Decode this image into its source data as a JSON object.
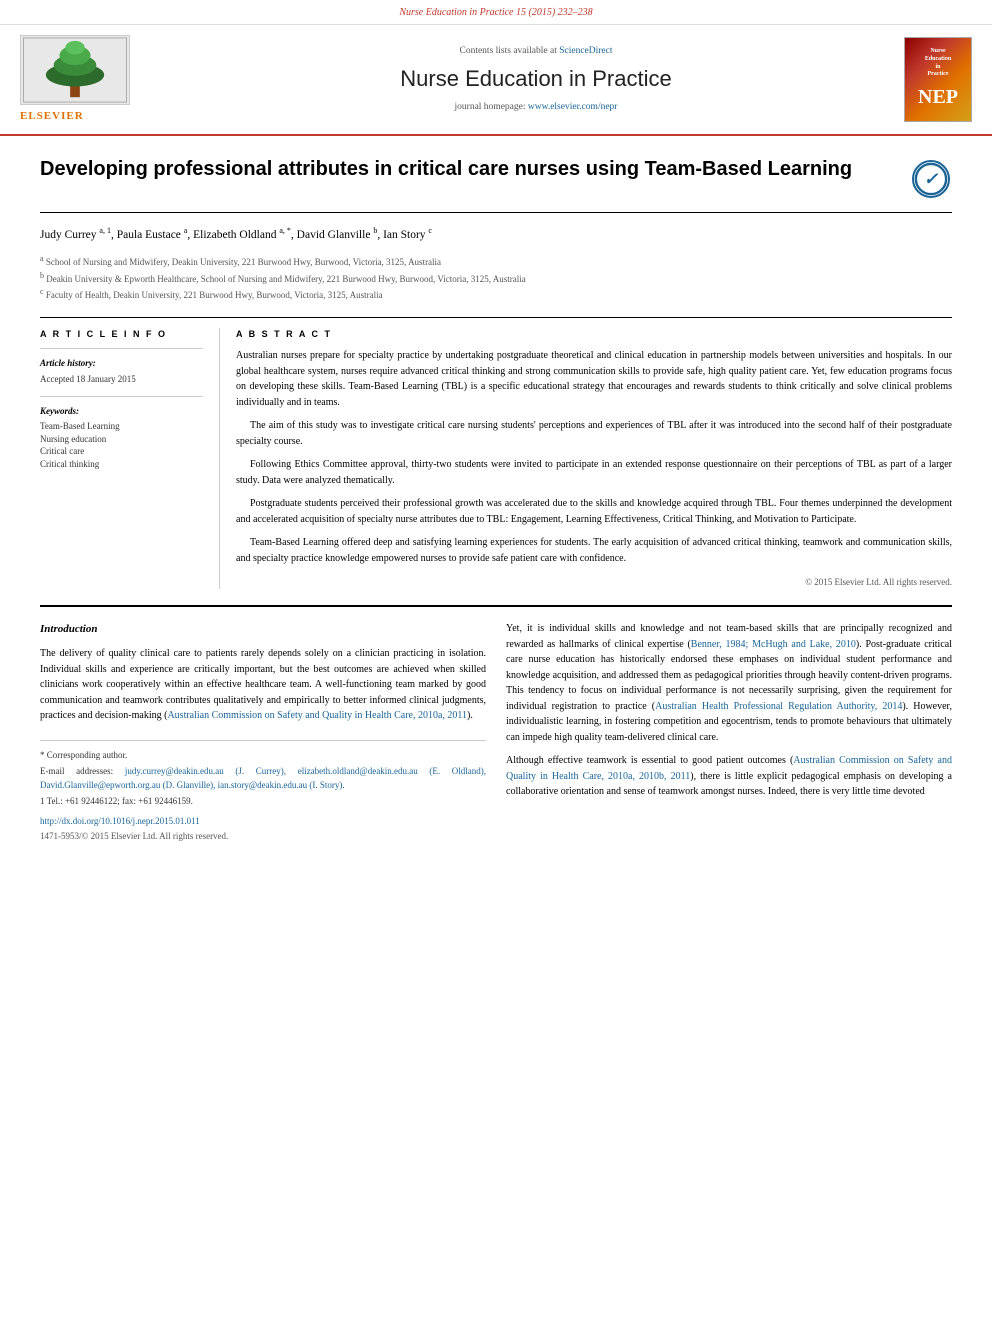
{
  "citation_bar": {
    "text": "Nurse Education in Practice 15 (2015) 232–238"
  },
  "header": {
    "contents_text": "Contents lists available at",
    "contents_link": "ScienceDirect",
    "journal_title": "Nurse Education in Practice",
    "homepage_text": "journal homepage:",
    "homepage_link": "www.elsevier.com/nepr",
    "elsevier_label": "ELSEVIER",
    "cover_title_lines": [
      "Nurse",
      "Education",
      "in",
      "Practice"
    ],
    "cover_initials": "NEP"
  },
  "article": {
    "title": "Developing professional attributes in critical care nurses using Team-Based Learning",
    "crossmark_symbol": "✓",
    "authors": "Judy Currey a, 1, Paula Eustace a, Elizabeth Oldland a, *, David Glanville b, Ian Story c",
    "affiliations": [
      {
        "sup": "a",
        "text": "School of Nursing and Midwifery, Deakin University, 221 Burwood Hwy, Burwood, Victoria, 3125, Australia"
      },
      {
        "sup": "b",
        "text": "Deakin University & Epworth Healthcare, School of Nursing and Midwifery, 221 Burwood Hwy, Burwood, Victoria, 3125, Australia"
      },
      {
        "sup": "c",
        "text": "Faculty of Health, Deakin University, 221 Burwood Hwy, Burwood, Victoria, 3125, Australia"
      }
    ]
  },
  "article_info": {
    "section_title": "A R T I C L E   I N F O",
    "history_label": "Article history:",
    "accepted_text": "Accepted 18 January 2015",
    "keywords_label": "Keywords:",
    "keywords": [
      "Team-Based Learning",
      "Nursing education",
      "Critical care",
      "Critical thinking"
    ]
  },
  "abstract": {
    "section_title": "A B S T R A C T",
    "paragraphs": [
      "Australian nurses prepare for specialty practice by undertaking postgraduate theoretical and clinical education in partnership models between universities and hospitals. In our global healthcare system, nurses require advanced critical thinking and strong communication skills to provide safe, high quality patient care. Yet, few education programs focus on developing these skills. Team-Based Learning (TBL) is a specific educational strategy that encourages and rewards students to think critically and solve clinical problems individually and in teams.",
      "The aim of this study was to investigate critical care nursing students' perceptions and experiences of TBL after it was introduced into the second half of their postgraduate specialty course.",
      "Following Ethics Committee approval, thirty-two students were invited to participate in an extended response questionnaire on their perceptions of TBL as part of a larger study. Data were analyzed thematically.",
      "Postgraduate students perceived their professional growth was accelerated due to the skills and knowledge acquired through TBL. Four themes underpinned the development and accelerated acquisition of specialty nurse attributes due to TBL: Engagement, Learning Effectiveness, Critical Thinking, and Motivation to Participate.",
      "Team-Based Learning offered deep and satisfying learning experiences for students. The early acquisition of advanced critical thinking, teamwork and communication skills, and specialty practice knowledge empowered nurses to provide safe patient care with confidence."
    ],
    "copyright": "© 2015 Elsevier Ltd. All rights reserved."
  },
  "introduction": {
    "title": "Introduction",
    "left_col_paragraphs": [
      "The delivery of quality clinical care to patients rarely depends solely on a clinician practicing in isolation. Individual skills and experience are critically important, but the best outcomes are achieved when skilled clinicians work cooperatively within an effective healthcare team. A well-functioning team marked by good communication and teamwork contributes qualitatively and empirically to better informed clinical judgments, practices and decision-making (Australian Commission on Safety and Quality in Health Care, 2010a, 2011).",
      "Yet, it is individual skills and knowledge and not team-based skills that are principally recognized and rewarded as hallmarks of clinical expertise (Benner, 1984; McHugh and Lake, 2010). Post-graduate critical care nurse education has historically endorsed these emphases on individual student performance and knowledge acquisition, and addressed them as pedagogical priorities through heavily content-driven programs. This tendency to focus on individual performance is not necessarily surprising, given the requirement for individual registration to practice (Australian Health Professional Regulation Authority, 2014). However, individualistic learning, in fostering competition and egocentrism, tends to promote behaviours that ultimately can impede high quality team-delivered clinical care."
    ],
    "right_col_paragraphs": [
      "Yet, it is individual skills and knowledge and not team-based skills that are principally recognized and rewarded as hallmarks of clinical expertise (Benner, 1984; McHugh and Lake, 2010). Post-graduate critical care nurse education has historically endorsed these emphases on individual student performance and knowledge acquisition, and addressed them as pedagogical priorities through heavily content-driven programs. This tendency to focus on individual performance is not necessarily surprising, given the requirement for individual registration to practice (Australian Health Professional Regulation Authority, 2014). However, individualistic learning, in fostering competition and egocentrism, tends to promote behaviours that ultimately can impede high quality team-delivered clinical care.",
      "Although effective teamwork is essential to good patient outcomes (Australian Commission on Safety and Quality in Health Care, 2010a, 2010b, 2011), there is little explicit pedagogical emphasis on developing a collaborative orientation and sense of teamwork amongst nurses. Indeed, there is very little time devoted"
    ]
  },
  "footnotes": {
    "corresponding_label": "* Corresponding author.",
    "email_label": "E-mail addresses:",
    "emails": "judy.currey@deakin.edu.au (J. Currey), elizabeth.oldland@deakin.edu.au (E. Oldland), David.Glanville@epworth.org.au (D. Glanville), ian.story@deakin.edu.au (I. Story).",
    "footnote1": "1 Tel.: +61 92446122; fax: +61 92446159.",
    "doi": "http://dx.doi.org/10.1016/j.nepr.2015.01.011",
    "issn": "1471-5953/© 2015 Elsevier Ltd. All rights reserved."
  }
}
